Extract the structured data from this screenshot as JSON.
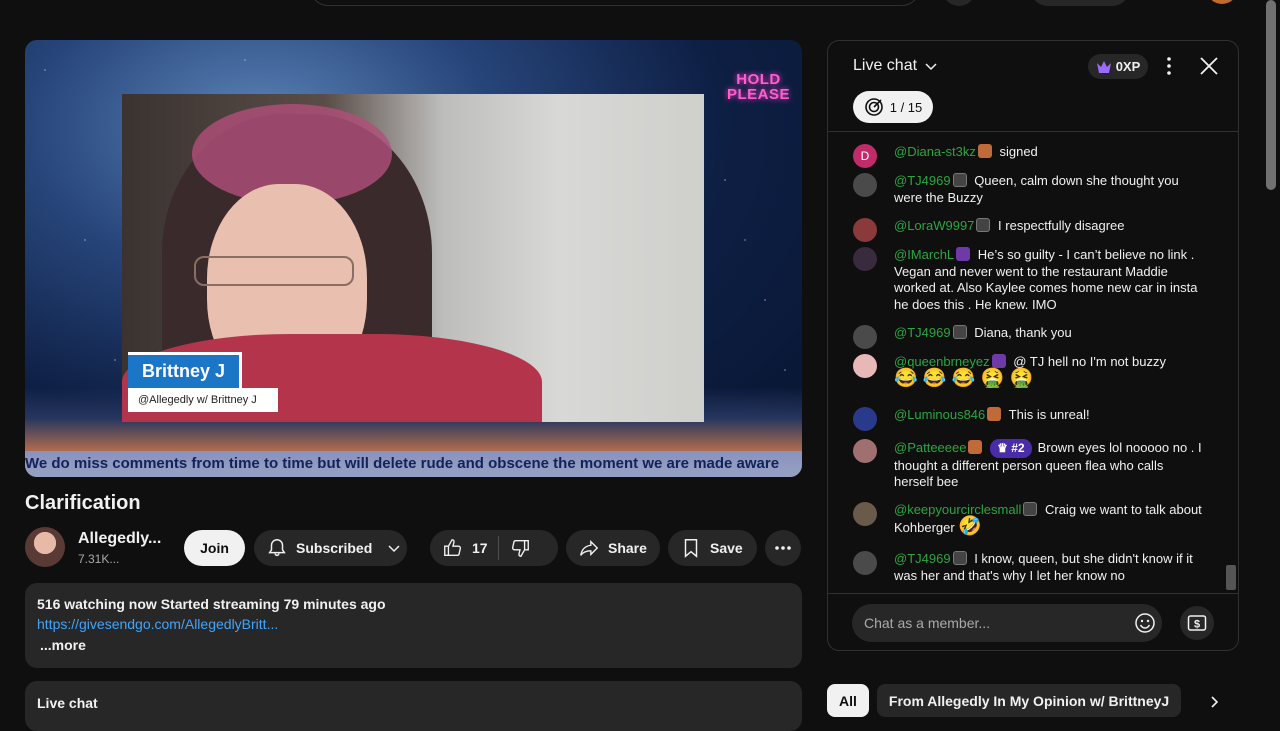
{
  "video": {
    "overlay_hold": "HOLD",
    "overlay_please": "PLEASE",
    "presenter_name": "Brittney J",
    "presenter_handle": "@Allegedly w/ Brittney J",
    "ticker": "We do miss comments from time to time but will delete rude and obscene the moment we are made aware"
  },
  "title": "Clarification",
  "channel": {
    "name": "Allegedly...",
    "subs": "7.31K..."
  },
  "actions": {
    "join": "Join",
    "subscribed": "Subscribed",
    "likes": "17",
    "share": "Share",
    "save": "Save"
  },
  "description": {
    "stats": "516 watching now  Started streaming 79 minutes ago",
    "link": "https://givesendgo.com/AllegedlyBritt...",
    "more": "...more"
  },
  "livechat_bar": "Live chat",
  "chat": {
    "title": "Live chat",
    "xp": "0XP",
    "goal": "1 / 15",
    "input_placeholder": "Chat as a member...",
    "messages": [
      {
        "author": "@Diana-st3kz",
        "text": "signed"
      },
      {
        "author": "@TJ4969",
        "text": "Queen, calm down she thought you were the Buzzy"
      },
      {
        "author": "@LoraW9997",
        "text": "I respectfully disagree"
      },
      {
        "author": "@IMarchL",
        "text": "He’s so guilty - I can’t believe no link . Vegan and never went to the restaurant Maddie worked at. Also Kaylee comes home new car in insta he does this . He knew. IMO"
      },
      {
        "author": "@TJ4969",
        "text": "Diana, thank you"
      },
      {
        "author": "@queenbrneyez",
        "text": "@ TJ hell no I'm not buzzy",
        "emojis": "😂 😂 😂 🤮 🤮"
      },
      {
        "author": "@Luminous846",
        "text": "This is unreal!"
      },
      {
        "author": "@Patteeeee",
        "rank": "#2",
        "text": "Brown eyes lol nooooo no . I thought a different person queen flea who calls herself bee"
      },
      {
        "author": "@keepyourcirclesmall",
        "text": "Craig we want to talk about Kohberger",
        "emojis": "🤣"
      },
      {
        "author": "@TJ4969",
        "text": "I know, queen, but she didn't know if it was her and that's why I let her know no"
      }
    ]
  },
  "chips": [
    "All",
    "From Allegedly In My Opinion w/ BrittneyJ"
  ],
  "colors": {
    "background": "#0f0f0f",
    "author_green": "#2ba640",
    "link_blue": "#3ea6ff"
  }
}
